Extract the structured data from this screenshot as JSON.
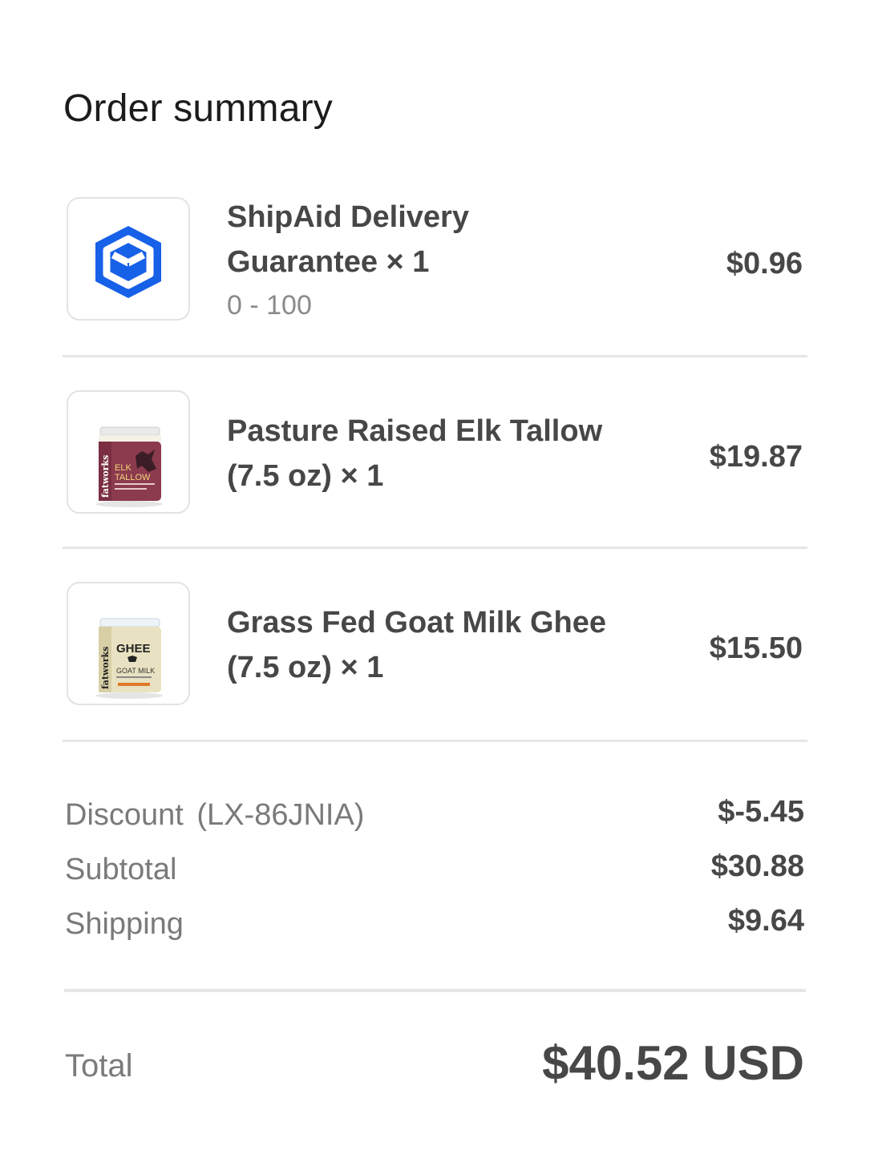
{
  "title": "Order summary",
  "items": [
    {
      "name_line1": "ShipAid Delivery",
      "name_line2": "Guarantee × 1",
      "variant": "0 - 100",
      "price": "$0.96",
      "thumbnail_icon": "shipaid-shield-icon",
      "thumbnail_color": "#1760e8"
    },
    {
      "name_line1": "Pasture Raised Elk Tallow",
      "name_line2": "(7.5 oz) × 1",
      "price": "$19.87",
      "thumbnail_icon": "elk-tallow-jar-image",
      "thumbnail_label": {
        "brand": "fatworks",
        "line1": "ELK",
        "line2": "TALLOW"
      },
      "thumbnail_color": "#8c3a4e"
    },
    {
      "name_line1": "Grass Fed Goat Milk Ghee",
      "name_line2": "(7.5 oz) × 1",
      "price": "$15.50",
      "thumbnail_icon": "goat-milk-ghee-jar-image",
      "thumbnail_label": {
        "brand": "fatworks",
        "line1": "GHEE",
        "line2": "GOAT MILK"
      },
      "thumbnail_color": "#e9e2c2"
    }
  ],
  "summary": {
    "discount_label": "Discount",
    "discount_code": "(LX-86JNIA)",
    "discount_value": "$-5.45",
    "subtotal_label": "Subtotal",
    "subtotal_value": "$30.88",
    "shipping_label": "Shipping",
    "shipping_value": "$9.64"
  },
  "total": {
    "label": "Total",
    "value": "$40.52 USD"
  }
}
